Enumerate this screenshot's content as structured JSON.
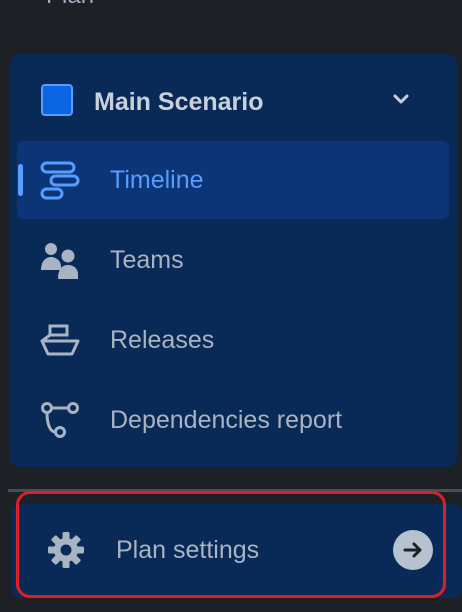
{
  "top_cut_text": "Plan",
  "scenario": {
    "name": "Main Scenario",
    "swatch_color": "#0c66e4",
    "toggle_icon": "chevron-down-icon"
  },
  "nav": {
    "items": [
      {
        "label": "Timeline",
        "icon": "timeline-icon",
        "active": true
      },
      {
        "label": "Teams",
        "icon": "people-icon",
        "active": false
      },
      {
        "label": "Releases",
        "icon": "ship-icon",
        "active": false
      },
      {
        "label": "Dependencies report",
        "icon": "dependencies-icon",
        "active": false
      }
    ]
  },
  "settings": {
    "label": "Plan settings",
    "icon": "gear-icon",
    "action_icon": "arrow-right-icon"
  },
  "colors": {
    "background": "#1d2125",
    "panel": "#092957",
    "active_item": "#0b3576",
    "accent": "#579dff",
    "highlight": "#e01e27"
  }
}
